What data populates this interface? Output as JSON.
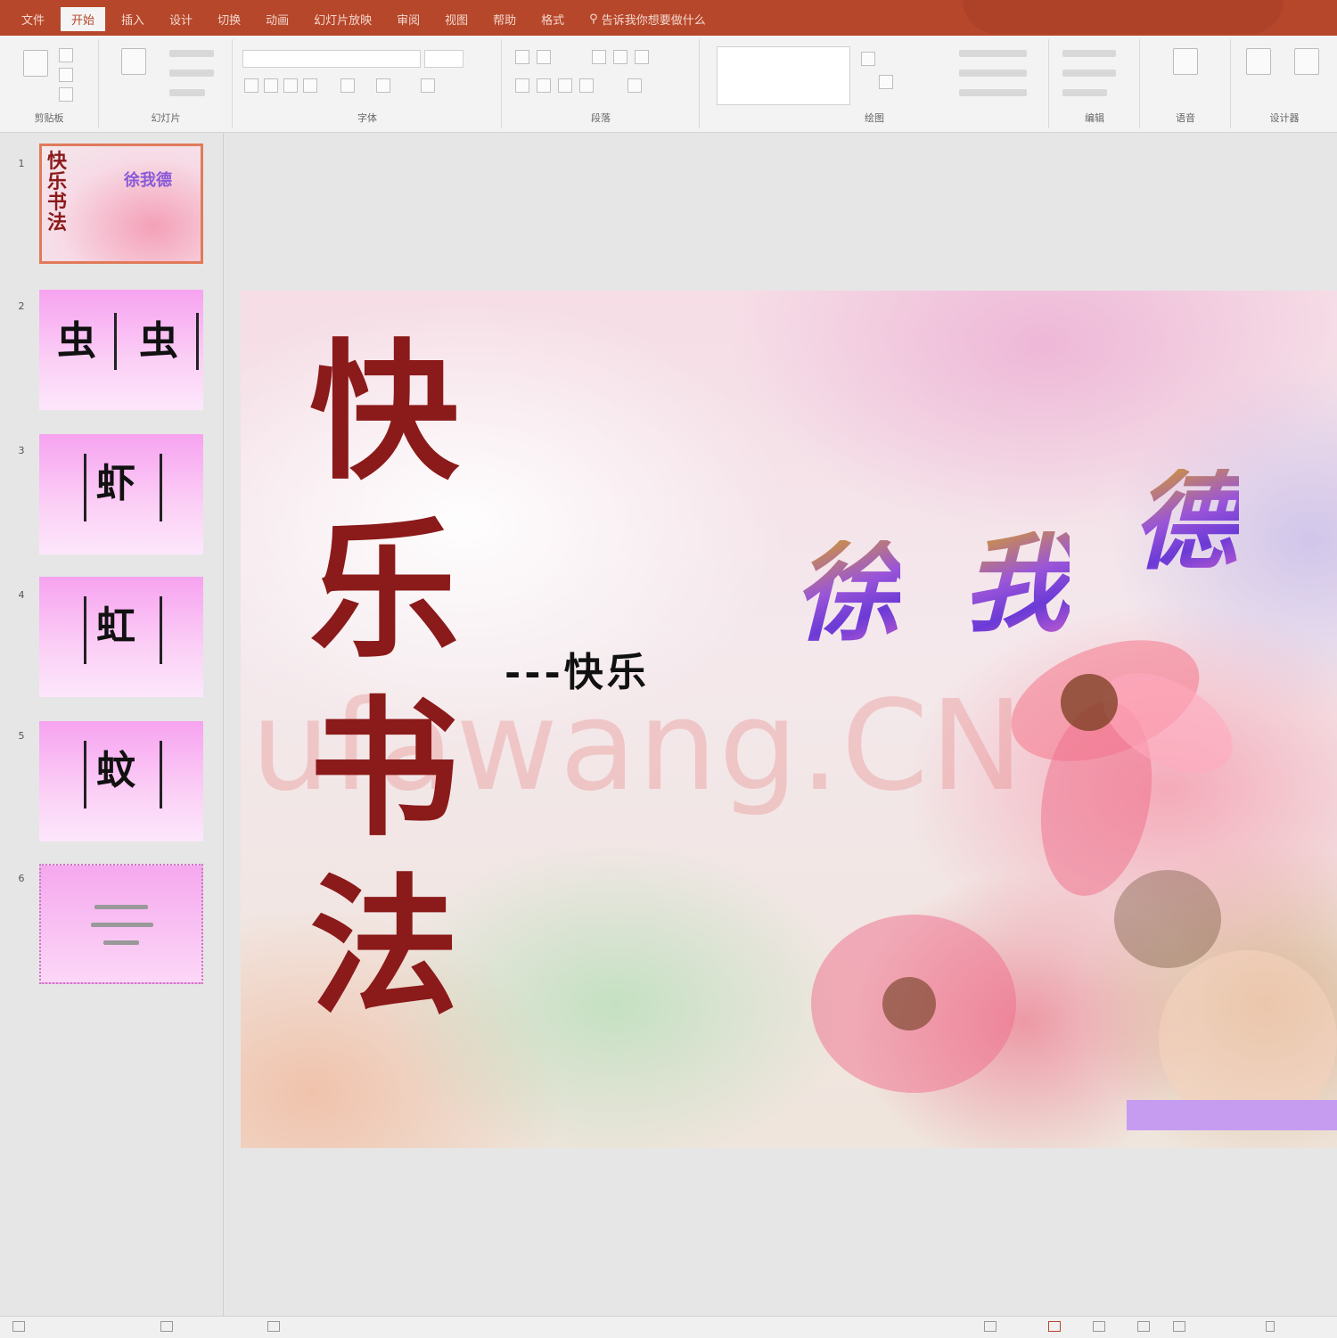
{
  "ribbon_tabs": [
    "文件",
    "开始",
    "插入",
    "设计",
    "切换",
    "动画",
    "幻灯片放映",
    "审阅",
    "视图",
    "帮助",
    "格式",
    "告诉我你想要做什么"
  ],
  "active_tab_index": 1,
  "tell_me": {
    "label": "告诉我你想要做什么"
  },
  "ribbon_groups": [
    "剪贴板",
    "幻灯片",
    "字体",
    "段落",
    "绘图",
    "编辑",
    "语音",
    "设计器"
  ],
  "slides": [
    {
      "number": "1",
      "title_text": "快乐书法",
      "author_text": "徐我德"
    },
    {
      "number": "2",
      "chars": [
        "虫",
        "虫"
      ]
    },
    {
      "number": "3",
      "chars": [
        "虾"
      ]
    },
    {
      "number": "4",
      "chars": [
        "虹"
      ]
    },
    {
      "number": "5",
      "chars": [
        "蚊"
      ]
    },
    {
      "number": "6"
    }
  ],
  "current_slide": {
    "title_chars": [
      "快",
      "乐",
      "书",
      "法"
    ],
    "subtitle": "---快乐",
    "wordart_chars": [
      "徐",
      "我",
      "德"
    ],
    "watermark": "Shufawang.CN"
  },
  "colors": {
    "titlebar": "#b7472a",
    "title_text": "#8b1a1a",
    "thumb_selected_border": "#e07a5a",
    "accent_bar": "#c69cf0"
  }
}
